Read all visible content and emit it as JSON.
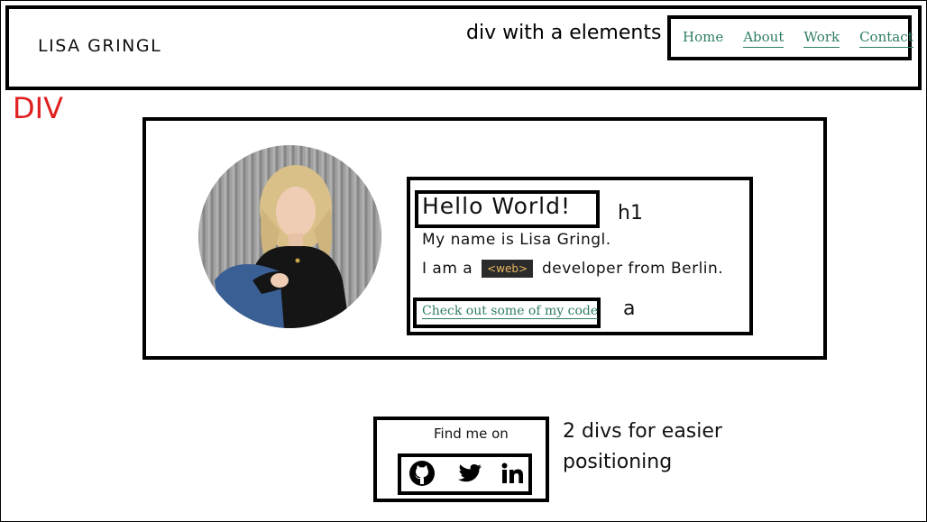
{
  "header": {
    "brand": "LISA GRINGL",
    "annotation": "div with a elements",
    "nav": [
      {
        "label": "Home"
      },
      {
        "label": "About"
      },
      {
        "label": "Work"
      },
      {
        "label": "Contact"
      }
    ]
  },
  "annotations": {
    "div": "DIV",
    "h1": "h1",
    "a": "a",
    "social": "2 divs for easier positioning"
  },
  "intro": {
    "heading": "Hello World!",
    "line1": "My name is Lisa Gringl.",
    "line2_prefix": "I am a",
    "tag": "<web>",
    "line2_suffix": "developer from Berlin.",
    "link": "Check out some of my code"
  },
  "social": {
    "title": "Find me on",
    "icons": [
      "github-icon",
      "twitter-icon",
      "linkedin-icon"
    ]
  },
  "colors": {
    "link": "#2f7d64",
    "annotation_red": "#e02020",
    "tag_bg": "#2b2b2b",
    "tag_text": "#e8b860"
  }
}
